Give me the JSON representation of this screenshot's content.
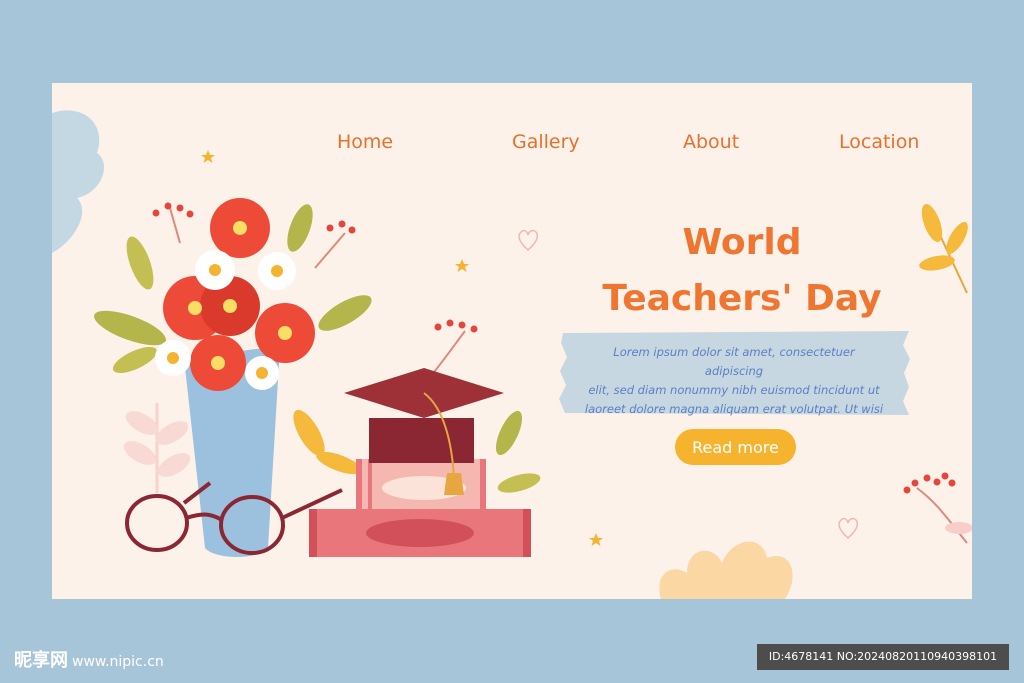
{
  "nav": {
    "items": [
      {
        "label": "Home"
      },
      {
        "label": "Gallery"
      },
      {
        "label": "About"
      },
      {
        "label": "Location"
      }
    ]
  },
  "hero": {
    "title_line1": "World",
    "title_line2": "Teachers' Day",
    "body_line1": "Lorem ipsum dolor sit amet, consectetuer adipiscing",
    "body_line2": "elit, sed diam nonummy nibh euismod tincidunt ut",
    "body_line3": "laoreet dolore magna aliquam erat volutpat. Ut wisi",
    "cta_label": "Read more"
  },
  "watermark": {
    "brand": "昵享网",
    "site": "www.nipic.cn",
    "id_text": "ID:4678141 NO:20240820110940398101"
  },
  "colors": {
    "page_bg": "#a7c5d8",
    "card_bg": "#fdf2e9",
    "accent_orange": "#ee7631",
    "button_yellow": "#f6b42e",
    "text_blue": "#5b7fc3",
    "tape_blue": "#c6d7e2"
  }
}
